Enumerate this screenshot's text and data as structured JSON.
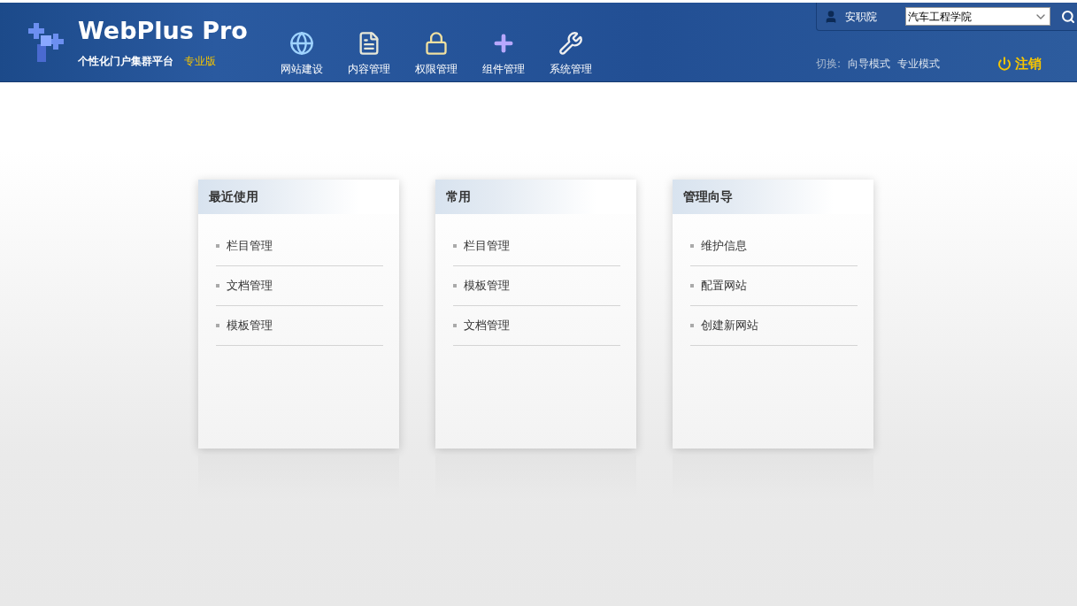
{
  "header": {
    "logo_title": "WebPlus Pro",
    "logo_subtitle": "个性化门户集群平台",
    "edition": "专业版",
    "nav": [
      {
        "kind": "globe",
        "label": "网站建设"
      },
      {
        "kind": "document",
        "label": "内容管理"
      },
      {
        "kind": "lock",
        "label": "权限管理"
      },
      {
        "kind": "component",
        "label": "组件管理"
      },
      {
        "kind": "tools",
        "label": "系统管理"
      }
    ],
    "user": "安职院",
    "site_select": {
      "value": "汽车工程学院"
    },
    "mode_switch": {
      "label": "切换:",
      "options": [
        "向导模式",
        "专业模式"
      ]
    },
    "logout": "注销"
  },
  "panels": [
    {
      "title": "最近使用",
      "items": [
        "栏目管理",
        "文档管理",
        "模板管理"
      ]
    },
    {
      "title": "常用",
      "items": [
        "栏目管理",
        "模板管理",
        "文档管理"
      ]
    },
    {
      "title": "管理向导",
      "items": [
        "维护信息",
        "配置网站",
        "创建新网站"
      ]
    }
  ]
}
